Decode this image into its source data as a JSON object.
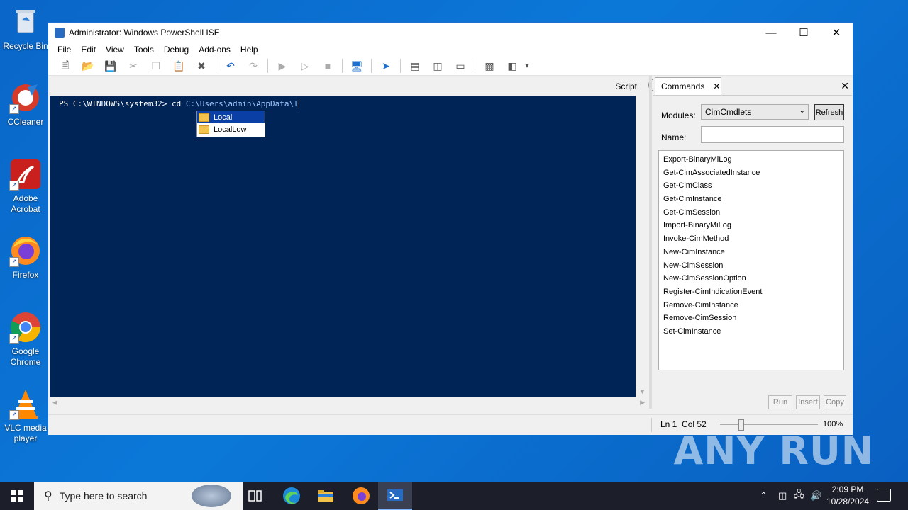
{
  "desktop": {
    "icons": [
      {
        "label": "Recycle Bin",
        "icon": "recycle-bin-icon"
      },
      {
        "label": "CCleaner",
        "icon": "ccleaner-icon"
      },
      {
        "label": "Adobe Acrobat",
        "icon": "acrobat-icon"
      },
      {
        "label": "Firefox",
        "icon": "firefox-icon"
      },
      {
        "label": "Google Chrome",
        "icon": "chrome-icon"
      },
      {
        "label": "VLC media player",
        "icon": "vlc-icon"
      }
    ],
    "watermark": "ANY RUN"
  },
  "window": {
    "title": "Administrator: Windows PowerShell ISE",
    "menu": [
      "File",
      "Edit",
      "View",
      "Tools",
      "Debug",
      "Add-ons",
      "Help"
    ],
    "script_label": "Script",
    "console": {
      "prompt": "PS C:\\WINDOWS\\system32> ",
      "command": "cd ",
      "argument": "C:\\Users\\admin\\AppData\\l"
    },
    "autocomplete": [
      {
        "label": "Local",
        "selected": true
      },
      {
        "label": "LocalLow",
        "selected": false
      }
    ],
    "commands_pane": {
      "tab_label": "Commands",
      "modules_label": "Modules:",
      "modules_value": "CimCmdlets",
      "refresh_label": "Refresh",
      "name_label": "Name:",
      "name_value": "",
      "commands": [
        "Export-BinaryMiLog",
        "Get-CimAssociatedInstance",
        "Get-CimClass",
        "Get-CimInstance",
        "Get-CimSession",
        "Import-BinaryMiLog",
        "Invoke-CimMethod",
        "New-CimInstance",
        "New-CimSession",
        "New-CimSessionOption",
        "Register-CimIndicationEvent",
        "Remove-CimInstance",
        "Remove-CimSession",
        "Set-CimInstance"
      ],
      "buttons": [
        "Run",
        "Insert",
        "Copy"
      ]
    },
    "status": {
      "position": "Ln 1  Col 52",
      "zoom": "100%"
    }
  },
  "taskbar": {
    "search_placeholder": "Type here to search",
    "time": "2:09 PM",
    "date": "10/28/2024"
  }
}
